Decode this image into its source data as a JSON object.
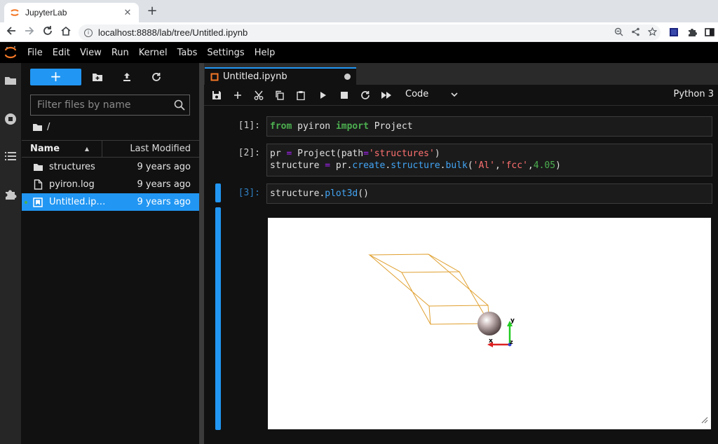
{
  "browser": {
    "tab_title": "JupyterLab",
    "tab_close": "✕",
    "new_tab": "+",
    "url": "localhost:8888/lab/tree/Untitled.ipynb"
  },
  "menu": {
    "items": [
      "File",
      "Edit",
      "View",
      "Run",
      "Kernel",
      "Tabs",
      "Settings",
      "Help"
    ]
  },
  "file_browser": {
    "new_button": "+",
    "filter_placeholder": "Filter files by name",
    "breadcrumb": "/",
    "columns": {
      "name": "Name",
      "modified": "Last Modified"
    },
    "files": [
      {
        "name": "structures",
        "modified": "9 years ago",
        "type": "folder"
      },
      {
        "name": "pyiron.log",
        "modified": "9 years ago",
        "type": "file"
      },
      {
        "name": "Untitled.ip…",
        "modified": "9 years ago",
        "type": "notebook",
        "selected": true,
        "running": true
      }
    ]
  },
  "notebook": {
    "tab_title": "Untitled.ipynb",
    "cell_type": "Code",
    "kernel_name": "Python 3",
    "cells": [
      {
        "prompt": "[1]:",
        "code": "from pyiron import Project"
      },
      {
        "prompt": "[2]:",
        "code": "pr = Project(path='structures')\nstructure = pr.create.structure.bulk('Al','fcc',4.05)"
      },
      {
        "prompt": "[3]:",
        "code": "structure.plot3d()"
      }
    ],
    "output_axes": {
      "x": "x",
      "y": "y",
      "z": "z"
    }
  },
  "colors": {
    "accent": "#2196f3",
    "jupyter_orange": "#f37726",
    "cell_wire": "#e0a030"
  }
}
